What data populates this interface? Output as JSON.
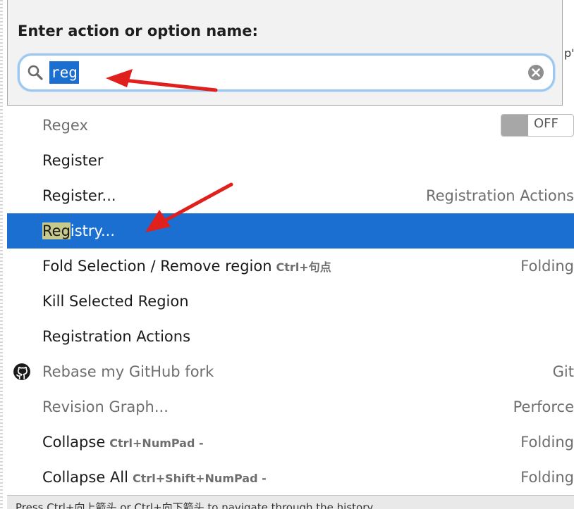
{
  "header": {
    "title": "Enter action or option name:",
    "search": {
      "value": "reg"
    },
    "edge_text": "p'"
  },
  "items": [
    {
      "label": "Regex",
      "group": "",
      "shortcut": "",
      "muted": true,
      "toggle": "OFF"
    },
    {
      "label": "Register",
      "group": "",
      "shortcut": ""
    },
    {
      "label": "Register...",
      "group": "Registration Actions",
      "shortcut": ""
    },
    {
      "label_highlight": "Reg",
      "label_rest": "istry...",
      "group": "",
      "shortcut": "",
      "selected": true
    },
    {
      "label": "Fold Selection / Remove region",
      "shortcut": "Ctrl+句点",
      "group": "Folding"
    },
    {
      "label": "Kill Selected Region",
      "group": "",
      "shortcut": ""
    },
    {
      "label": "Registration Actions",
      "group": "",
      "shortcut": ""
    },
    {
      "label": "Rebase my GitHub fork",
      "group": "Git",
      "shortcut": "",
      "muted": true,
      "icon": "github-icon"
    },
    {
      "label": "Revision Graph...",
      "group": "Perforce",
      "shortcut": "",
      "muted": true
    },
    {
      "label": "Collapse",
      "shortcut": "Ctrl+NumPad -",
      "group": "Folding"
    },
    {
      "label": "Collapse All",
      "shortcut": "Ctrl+Shift+NumPad -",
      "group": "Folding"
    }
  ],
  "footer": {
    "hint": "Press Ctrl+向上箭头 or Ctrl+向下箭头 to navigate through the history"
  },
  "colors": {
    "selection": "#1a6fd1",
    "annotation_arrow": "#e0201c",
    "search_border": "#9cc7ef"
  }
}
